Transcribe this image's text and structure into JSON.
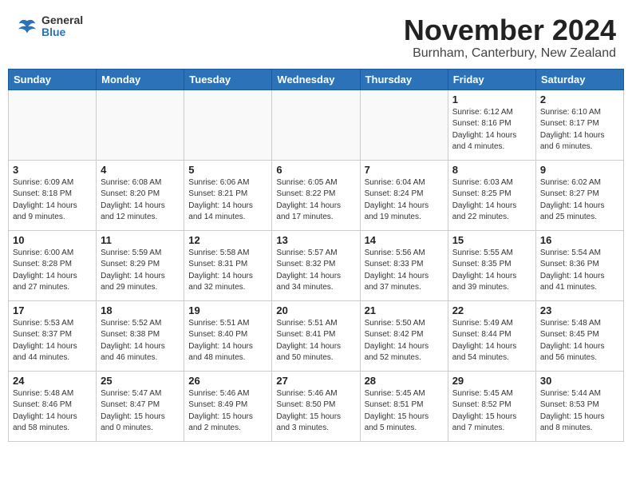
{
  "header": {
    "logo_general": "General",
    "logo_blue": "Blue",
    "month_title": "November 2024",
    "subtitle": "Burnham, Canterbury, New Zealand"
  },
  "days_of_week": [
    "Sunday",
    "Monday",
    "Tuesday",
    "Wednesday",
    "Thursday",
    "Friday",
    "Saturday"
  ],
  "weeks": [
    [
      {
        "day": "",
        "info": ""
      },
      {
        "day": "",
        "info": ""
      },
      {
        "day": "",
        "info": ""
      },
      {
        "day": "",
        "info": ""
      },
      {
        "day": "",
        "info": ""
      },
      {
        "day": "1",
        "info": "Sunrise: 6:12 AM\nSunset: 8:16 PM\nDaylight: 14 hours\nand 4 minutes."
      },
      {
        "day": "2",
        "info": "Sunrise: 6:10 AM\nSunset: 8:17 PM\nDaylight: 14 hours\nand 6 minutes."
      }
    ],
    [
      {
        "day": "3",
        "info": "Sunrise: 6:09 AM\nSunset: 8:18 PM\nDaylight: 14 hours\nand 9 minutes."
      },
      {
        "day": "4",
        "info": "Sunrise: 6:08 AM\nSunset: 8:20 PM\nDaylight: 14 hours\nand 12 minutes."
      },
      {
        "day": "5",
        "info": "Sunrise: 6:06 AM\nSunset: 8:21 PM\nDaylight: 14 hours\nand 14 minutes."
      },
      {
        "day": "6",
        "info": "Sunrise: 6:05 AM\nSunset: 8:22 PM\nDaylight: 14 hours\nand 17 minutes."
      },
      {
        "day": "7",
        "info": "Sunrise: 6:04 AM\nSunset: 8:24 PM\nDaylight: 14 hours\nand 19 minutes."
      },
      {
        "day": "8",
        "info": "Sunrise: 6:03 AM\nSunset: 8:25 PM\nDaylight: 14 hours\nand 22 minutes."
      },
      {
        "day": "9",
        "info": "Sunrise: 6:02 AM\nSunset: 8:27 PM\nDaylight: 14 hours\nand 25 minutes."
      }
    ],
    [
      {
        "day": "10",
        "info": "Sunrise: 6:00 AM\nSunset: 8:28 PM\nDaylight: 14 hours\nand 27 minutes."
      },
      {
        "day": "11",
        "info": "Sunrise: 5:59 AM\nSunset: 8:29 PM\nDaylight: 14 hours\nand 29 minutes."
      },
      {
        "day": "12",
        "info": "Sunrise: 5:58 AM\nSunset: 8:31 PM\nDaylight: 14 hours\nand 32 minutes."
      },
      {
        "day": "13",
        "info": "Sunrise: 5:57 AM\nSunset: 8:32 PM\nDaylight: 14 hours\nand 34 minutes."
      },
      {
        "day": "14",
        "info": "Sunrise: 5:56 AM\nSunset: 8:33 PM\nDaylight: 14 hours\nand 37 minutes."
      },
      {
        "day": "15",
        "info": "Sunrise: 5:55 AM\nSunset: 8:35 PM\nDaylight: 14 hours\nand 39 minutes."
      },
      {
        "day": "16",
        "info": "Sunrise: 5:54 AM\nSunset: 8:36 PM\nDaylight: 14 hours\nand 41 minutes."
      }
    ],
    [
      {
        "day": "17",
        "info": "Sunrise: 5:53 AM\nSunset: 8:37 PM\nDaylight: 14 hours\nand 44 minutes."
      },
      {
        "day": "18",
        "info": "Sunrise: 5:52 AM\nSunset: 8:38 PM\nDaylight: 14 hours\nand 46 minutes."
      },
      {
        "day": "19",
        "info": "Sunrise: 5:51 AM\nSunset: 8:40 PM\nDaylight: 14 hours\nand 48 minutes."
      },
      {
        "day": "20",
        "info": "Sunrise: 5:51 AM\nSunset: 8:41 PM\nDaylight: 14 hours\nand 50 minutes."
      },
      {
        "day": "21",
        "info": "Sunrise: 5:50 AM\nSunset: 8:42 PM\nDaylight: 14 hours\nand 52 minutes."
      },
      {
        "day": "22",
        "info": "Sunrise: 5:49 AM\nSunset: 8:44 PM\nDaylight: 14 hours\nand 54 minutes."
      },
      {
        "day": "23",
        "info": "Sunrise: 5:48 AM\nSunset: 8:45 PM\nDaylight: 14 hours\nand 56 minutes."
      }
    ],
    [
      {
        "day": "24",
        "info": "Sunrise: 5:48 AM\nSunset: 8:46 PM\nDaylight: 14 hours\nand 58 minutes."
      },
      {
        "day": "25",
        "info": "Sunrise: 5:47 AM\nSunset: 8:47 PM\nDaylight: 15 hours\nand 0 minutes."
      },
      {
        "day": "26",
        "info": "Sunrise: 5:46 AM\nSunset: 8:49 PM\nDaylight: 15 hours\nand 2 minutes."
      },
      {
        "day": "27",
        "info": "Sunrise: 5:46 AM\nSunset: 8:50 PM\nDaylight: 15 hours\nand 3 minutes."
      },
      {
        "day": "28",
        "info": "Sunrise: 5:45 AM\nSunset: 8:51 PM\nDaylight: 15 hours\nand 5 minutes."
      },
      {
        "day": "29",
        "info": "Sunrise: 5:45 AM\nSunset: 8:52 PM\nDaylight: 15 hours\nand 7 minutes."
      },
      {
        "day": "30",
        "info": "Sunrise: 5:44 AM\nSunset: 8:53 PM\nDaylight: 15 hours\nand 8 minutes."
      }
    ]
  ]
}
